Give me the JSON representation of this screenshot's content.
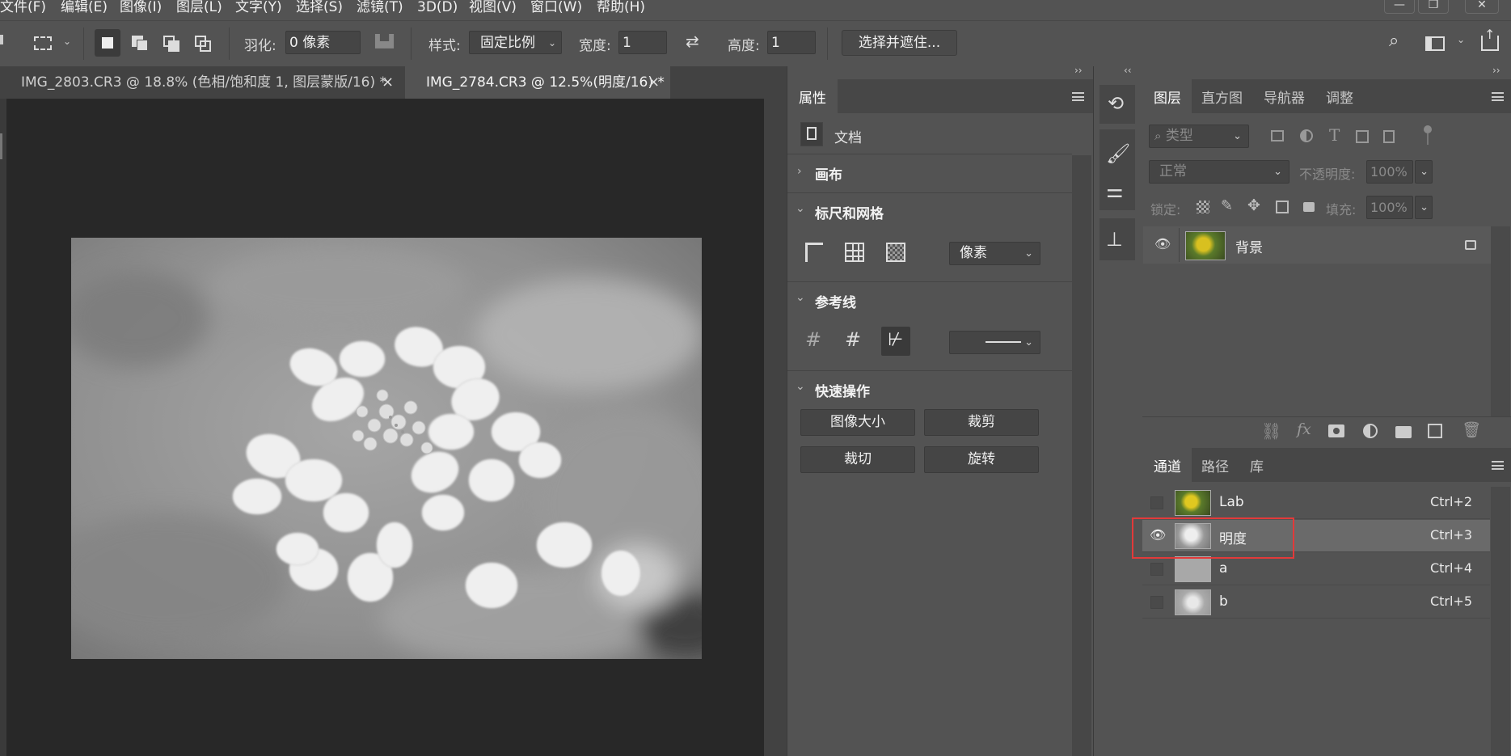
{
  "menu": [
    "文件(F)",
    "编辑(E)",
    "图像(I)",
    "图层(L)",
    "文字(Y)",
    "选择(S)",
    "滤镜(T)",
    "3D(D)",
    "视图(V)",
    "窗口(W)",
    "帮助(H)"
  ],
  "window_controls": {
    "minimize": "—",
    "restore": "❐",
    "close": "✕"
  },
  "options": {
    "feather_label": "羽化:",
    "feather_value": "0 像素",
    "style_label": "样式:",
    "style_value": "固定比例",
    "width_label": "宽度:",
    "width_value": "1",
    "height_label": "高度:",
    "height_value": "1",
    "select_mask_button": "选择并遮住..."
  },
  "doc_tabs": [
    {
      "title": "IMG_2803.CR3 @ 18.8% (色相/饱和度 1, 图层蒙版/16) *",
      "close": "×",
      "active": false
    },
    {
      "title": "IMG_2784.CR3 @ 12.5%(明度/16) *",
      "close": "×",
      "active": true
    }
  ],
  "properties": {
    "tab": "属性",
    "doc_label": "文档",
    "sections": {
      "canvas": "画布",
      "rulers_grid": "标尺和网格",
      "guides": "参考线",
      "quick_actions": "快速操作"
    },
    "units_value": "像素",
    "quick_buttons": [
      "图像大小",
      "裁剪",
      "裁切",
      "旋转"
    ]
  },
  "layers_panel": {
    "tabs": [
      "图层",
      "直方图",
      "导航器",
      "调整"
    ],
    "filter_placeholder": "类型",
    "blend_mode": "正常",
    "opacity_label": "不透明度:",
    "opacity_value": "100%",
    "lock_label": "锁定:",
    "fill_label": "填充:",
    "fill_value": "100%",
    "layer_name": "背景"
  },
  "channels_panel": {
    "tabs": [
      "通道",
      "路径",
      "库"
    ],
    "channels": [
      {
        "name": "Lab",
        "shortcut": "Ctrl+2",
        "visible": false,
        "selected": false
      },
      {
        "name": "明度",
        "shortcut": "Ctrl+3",
        "visible": true,
        "selected": true
      },
      {
        "name": "a",
        "shortcut": "Ctrl+4",
        "visible": false,
        "selected": false
      },
      {
        "name": "b",
        "shortcut": "Ctrl+5",
        "visible": false,
        "selected": false
      }
    ]
  },
  "colors": {
    "highlight": "#e23a3a",
    "selected_row": "#6a6a6a",
    "canvas_bg": "#282828"
  }
}
